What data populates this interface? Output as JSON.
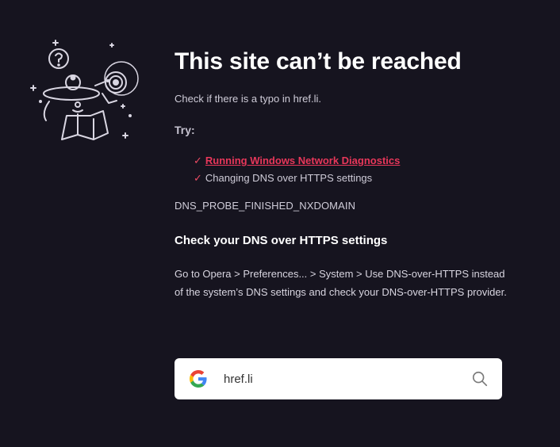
{
  "error_page": {
    "title": "This site can’t be reached",
    "subtitle": "Check if there is a typo in href.li.",
    "try_label": "Try:",
    "suggestions": [
      {
        "check": "✓",
        "label": "Running Windows Network Diagnostics",
        "is_link": true
      },
      {
        "check": "✓",
        "label": "Changing DNS over HTTPS settings",
        "is_link": false
      }
    ],
    "error_code": "DNS_PROBE_FINISHED_NXDOMAIN",
    "dns_heading": "Check your DNS over HTTPS settings",
    "dns_body": "Go to Opera > Preferences... > System > Use DNS-over-HTTPS instead of the system’s DNS settings and check your DNS-over-HTTPS provider."
  },
  "search": {
    "engine_icon": "google-g-icon",
    "value": "href.li",
    "button_icon": "search-icon"
  },
  "colors": {
    "background": "#16141f",
    "accent": "#e8375a",
    "text": "#cfccd8"
  }
}
